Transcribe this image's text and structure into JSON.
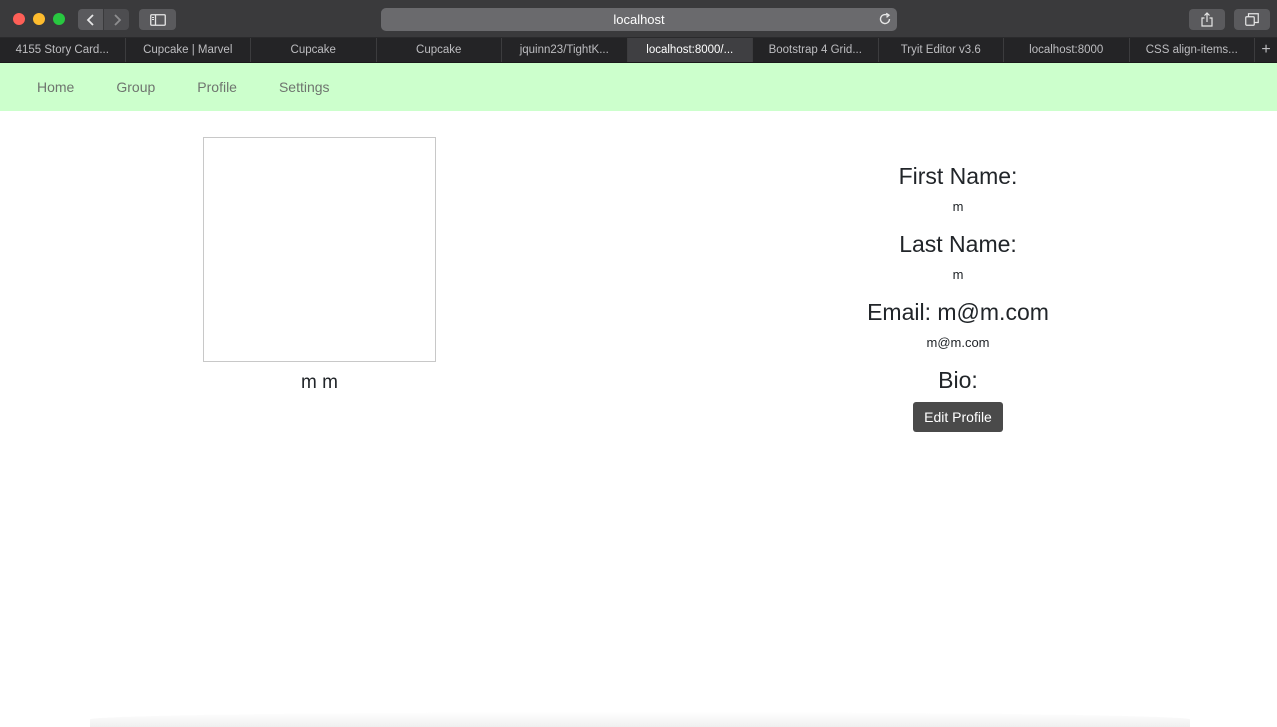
{
  "browser": {
    "address": "localhost",
    "tabs": [
      {
        "label": "4155 Story Card..."
      },
      {
        "label": "Cupcake | Marvel"
      },
      {
        "label": "Cupcake"
      },
      {
        "label": "Cupcake"
      },
      {
        "label": "jquinn23/TightK..."
      },
      {
        "label": "localhost:8000/..."
      },
      {
        "label": "Bootstrap 4 Grid..."
      },
      {
        "label": "Tryit Editor v3.6"
      },
      {
        "label": "localhost:8000"
      },
      {
        "label": "CSS align-items..."
      }
    ],
    "active_tab_index": 5,
    "new_tab_symbol": "+"
  },
  "nav": {
    "items": [
      {
        "label": "Home"
      },
      {
        "label": "Group"
      },
      {
        "label": "Profile"
      },
      {
        "label": "Settings"
      }
    ],
    "background": "#ccffcc"
  },
  "profile": {
    "full_name": "m m",
    "first_name_heading": "First Name:",
    "first_name_value": "m",
    "last_name_heading": "Last Name:",
    "last_name_value": "m",
    "email_heading": "Email: m@m.com",
    "email_value": "m@m.com",
    "bio_heading": "Bio:",
    "edit_button_label": "Edit Profile"
  }
}
